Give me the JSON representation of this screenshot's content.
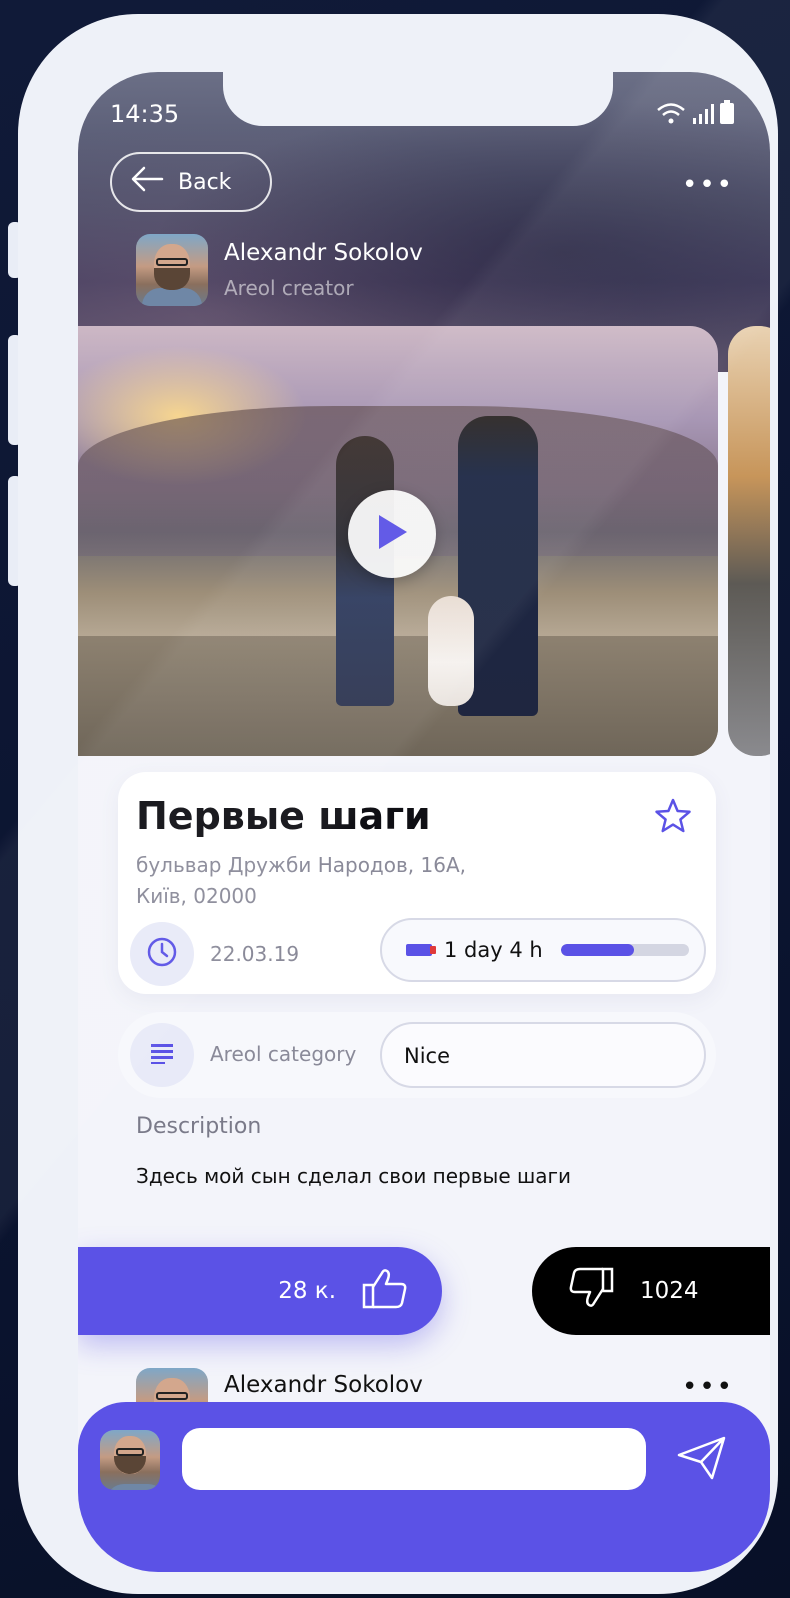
{
  "status_bar": {
    "time": "14:35"
  },
  "nav": {
    "back_label": "Back",
    "more_label": "•••"
  },
  "author": {
    "name": "Alexandr Sokolov",
    "role": "Areol creator"
  },
  "post": {
    "title": "Первые шаги",
    "address": "бульвар Дружби Народов, 16А, Київ, 02000",
    "date": "22.03.19",
    "duration": "1 day 4 h",
    "duration_progress": 0.57,
    "category_label": "Areol category",
    "category_value": "Nice",
    "description_label": "Description",
    "description": "Здесь мой сын сделал свои первые шаги"
  },
  "reactions": {
    "likes": "28 к.",
    "dislikes": "1024"
  },
  "comment": {
    "author": "Alexandr Sokolov",
    "more_label": "•••"
  },
  "composer": {
    "placeholder": ""
  },
  "colors": {
    "accent": "#5b52e6",
    "dark": "#000000",
    "muted": "#8a8a99"
  },
  "icons": {
    "back": "arrow-left-icon",
    "more": "more-dots-icon",
    "play": "play-icon",
    "favorite": "star-icon",
    "date": "clock-icon",
    "battery": "battery-icon",
    "category": "list-icon",
    "like": "thumbs-up-icon",
    "dislike": "thumbs-down-icon",
    "send": "send-icon"
  }
}
